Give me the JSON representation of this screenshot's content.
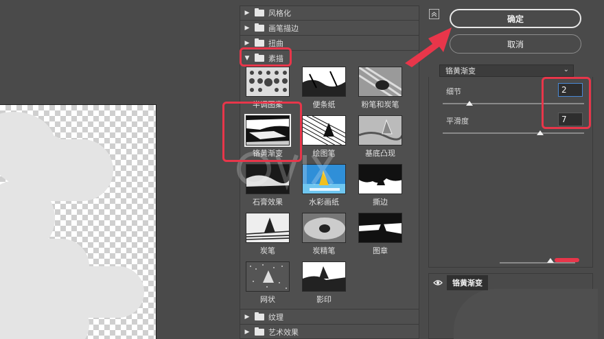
{
  "preview": {
    "label": "preview-canvas"
  },
  "gallery": {
    "categories_top": [
      {
        "label": "风格化",
        "expanded": false
      },
      {
        "label": "画笔描边",
        "expanded": false
      },
      {
        "label": "扭曲",
        "expanded": false
      },
      {
        "label": "素描",
        "expanded": true
      }
    ],
    "sketch_filters": [
      {
        "label": "半调图案"
      },
      {
        "label": "便条纸"
      },
      {
        "label": "粉笔和炭笔"
      },
      {
        "label": "铬黄渐变",
        "selected": true
      },
      {
        "label": "绘图笔"
      },
      {
        "label": "基底凸现"
      },
      {
        "label": "石膏效果"
      },
      {
        "label": "水彩画纸"
      },
      {
        "label": "撕边"
      },
      {
        "label": "炭笔"
      },
      {
        "label": "炭精笔"
      },
      {
        "label": "图章"
      },
      {
        "label": "网状"
      },
      {
        "label": "影印"
      }
    ],
    "categories_bottom": [
      {
        "label": "纹理",
        "expanded": false
      },
      {
        "label": "艺术效果",
        "expanded": false
      }
    ]
  },
  "panel": {
    "collapse_icon": "collapse-up-icon",
    "ok_label": "确定",
    "cancel_label": "取消",
    "filter_selected": "铬黄渐变",
    "params": [
      {
        "label": "细节",
        "value": "2",
        "slider_fraction": 0.2
      },
      {
        "label": "平滑度",
        "value": "7",
        "slider_fraction": 0.7
      }
    ],
    "layer_name": "铬黄渐变",
    "eye_icon": "eye-icon"
  },
  "annotations": {
    "color": "#e8364a"
  }
}
